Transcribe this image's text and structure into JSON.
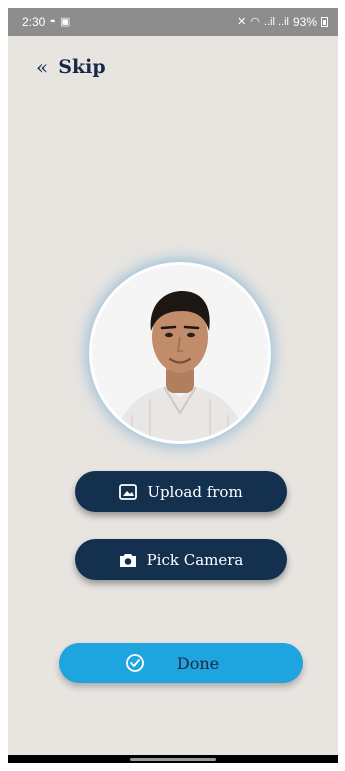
{
  "status_bar": {
    "time": "2:30",
    "battery_percent": "93%",
    "signal_text": "..il ..il",
    "left_icons": [
      "eye-icon",
      "image-icon"
    ],
    "right_icons": [
      "mute-icon",
      "wifi-icon",
      "signal-icon",
      "battery-icon"
    ]
  },
  "header": {
    "skip_icon": "«",
    "skip_label": "Skip"
  },
  "profile": {
    "photo_description": "profile-photo-icon"
  },
  "actions": {
    "upload_label": "Upload from",
    "camera_label": "Pick Camera",
    "done_label": "Done"
  },
  "colors": {
    "background": "#e8e5e1",
    "primary_dark": "#14304f",
    "accent": "#1ea4de",
    "glow": "#5da0cd"
  }
}
